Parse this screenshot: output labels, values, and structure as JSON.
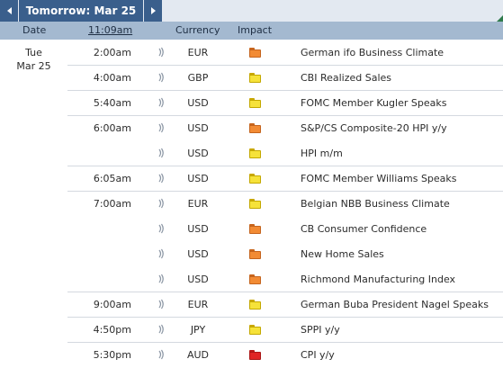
{
  "nav": {
    "title": "Tomorrow: Mar 25"
  },
  "columns": {
    "date": "Date",
    "time": "11:09am",
    "currency": "Currency",
    "impact": "Impact"
  },
  "date": {
    "weekday": "Tue",
    "day": "Mar 25"
  },
  "impact_colors": {
    "high": "#e02525",
    "medium": "#f28b34",
    "low": "#f6e23a"
  },
  "events": [
    {
      "time": "2:00am",
      "currency": "EUR",
      "impact": "medium",
      "name": "German ifo Business Climate"
    },
    {
      "time": "4:00am",
      "currency": "GBP",
      "impact": "low",
      "name": "CBI Realized Sales"
    },
    {
      "time": "5:40am",
      "currency": "USD",
      "impact": "low",
      "name": "FOMC Member Kugler Speaks"
    },
    {
      "time": "6:00am",
      "currency": "USD",
      "impact": "medium",
      "name": "S&P/CS Composite-20 HPI y/y"
    },
    {
      "time": "",
      "currency": "USD",
      "impact": "low",
      "name": "HPI m/m"
    },
    {
      "time": "6:05am",
      "currency": "USD",
      "impact": "low",
      "name": "FOMC Member Williams Speaks"
    },
    {
      "time": "7:00am",
      "currency": "EUR",
      "impact": "low",
      "name": "Belgian NBB Business Climate"
    },
    {
      "time": "",
      "currency": "USD",
      "impact": "medium",
      "name": "CB Consumer Confidence"
    },
    {
      "time": "",
      "currency": "USD",
      "impact": "medium",
      "name": "New Home Sales"
    },
    {
      "time": "",
      "currency": "USD",
      "impact": "medium",
      "name": "Richmond Manufacturing Index"
    },
    {
      "time": "9:00am",
      "currency": "EUR",
      "impact": "low",
      "name": "German Buba President Nagel Speaks"
    },
    {
      "time": "4:50pm",
      "currency": "JPY",
      "impact": "low",
      "name": "SPPI y/y"
    },
    {
      "time": "5:30pm",
      "currency": "AUD",
      "impact": "high",
      "name": "CPI y/y"
    }
  ]
}
